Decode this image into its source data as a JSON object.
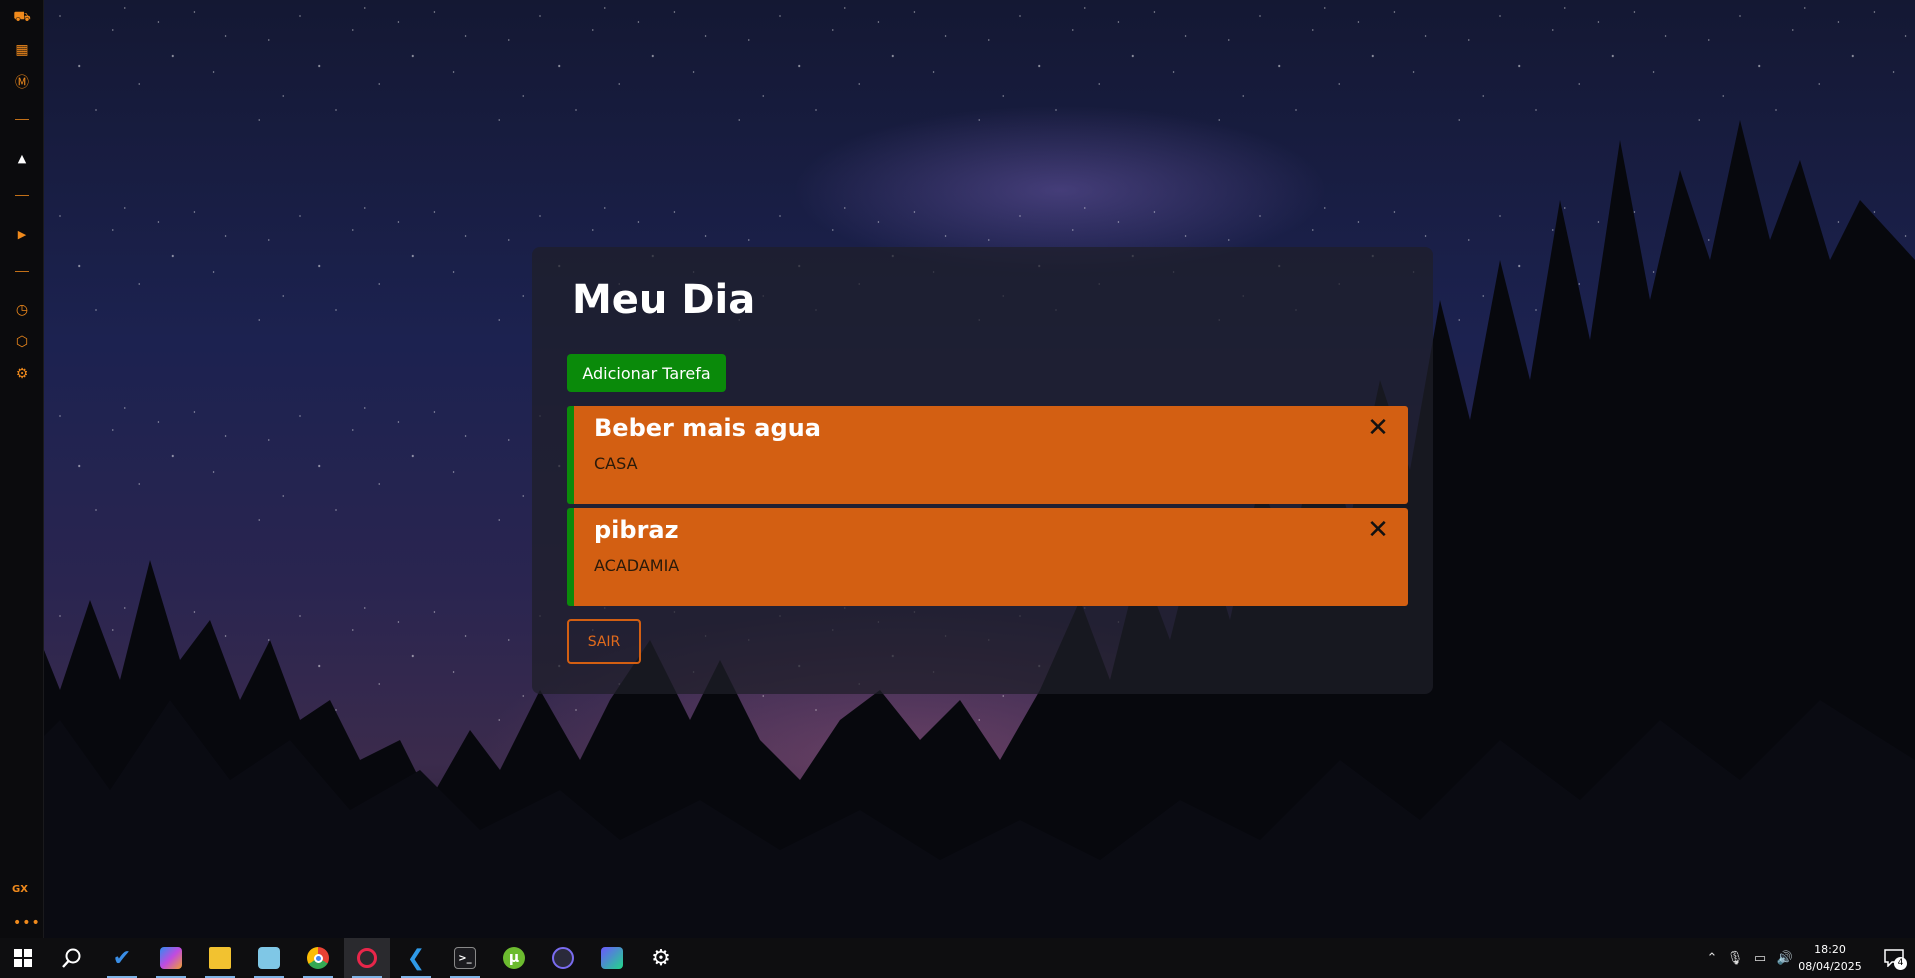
{
  "sidebar": {
    "items": [
      {
        "name": "sidebar-item-1",
        "glyph": "⛟"
      },
      {
        "name": "sidebar-item-2",
        "glyph": "▦"
      },
      {
        "name": "sidebar-item-3",
        "glyph": "Ⓜ"
      },
      {
        "name": "sidebar-item-4",
        "glyph": "▲"
      },
      {
        "name": "sidebar-item-5",
        "glyph": "▶"
      },
      {
        "name": "sidebar-item-6",
        "glyph": "◷"
      },
      {
        "name": "sidebar-item-7",
        "glyph": "⬡"
      },
      {
        "name": "sidebar-item-8",
        "glyph": "⚙"
      }
    ],
    "gx_label": "GX",
    "more_label": "•••",
    "accent": "#f08a1c"
  },
  "card": {
    "title": "Meu Dia",
    "add_label": "Adicionar Tarefa",
    "exit_label": "SAIR",
    "tasks": [
      {
        "title": "Beber mais agua",
        "category": "CASA"
      },
      {
        "title": "pibraz",
        "category": "ACADAMIA"
      }
    ],
    "task_color": "#d35f12",
    "accent_green": "#0a8a0a"
  },
  "taskbar": {
    "apps": [
      "start",
      "search",
      "todo",
      "copilot",
      "file-explorer",
      "notepad",
      "chrome",
      "opera-gx",
      "vscode",
      "terminal",
      "utorrent",
      "obs",
      "jetbrains",
      "settings"
    ],
    "time": "18:20",
    "date": "08/04/2025",
    "notification_count": "4"
  }
}
